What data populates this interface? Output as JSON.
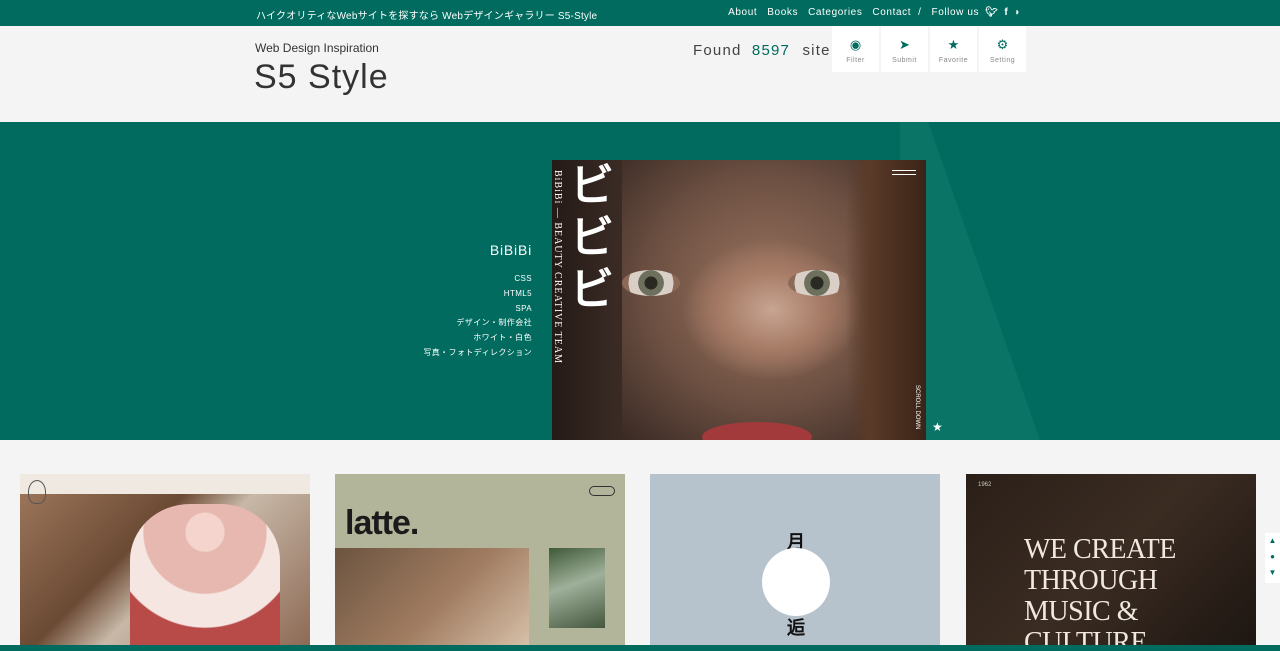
{
  "topbar": {
    "tagline": "ハイクオリティなWebサイトを探すなら Webデザインギャラリー S5-Style",
    "nav": [
      "About",
      "Books",
      "Categories",
      "Contact"
    ],
    "separator": "/",
    "follow": "Follow us",
    "social_icons": [
      "twitter-icon",
      "facebook-icon",
      "rss-icon"
    ]
  },
  "header": {
    "subtitle": "Web Design Inspiration",
    "logo": "S5 Style",
    "found_label": "Found",
    "found_count": "8597",
    "found_unit": "site",
    "tools": [
      {
        "label": "Filter",
        "icon": "eye-icon",
        "glyph": "◉"
      },
      {
        "label": "Submit",
        "icon": "send-icon",
        "glyph": "➤"
      },
      {
        "label": "Favorite",
        "icon": "star-icon",
        "glyph": "★"
      },
      {
        "label": "Setting",
        "icon": "gear-icon",
        "glyph": "⚙"
      }
    ]
  },
  "featured": {
    "title": "BiBiBi",
    "tags": [
      "CSS",
      "HTML5",
      "SPA",
      "デザイン・制作会社",
      "ホワイト・白色",
      "写真・フォトディレクション"
    ],
    "screenshot_vertical_text": "BiBiBi — BEAUTY CREATIVE TEAM",
    "screenshot_kana": [
      "ビ",
      "ビ",
      "ビ"
    ],
    "screenshot_scroll": "SCROLL DOWN"
  },
  "gallery": [
    {
      "name": "kimono-site",
      "kind": "photo"
    },
    {
      "name": "latte",
      "headline": "latte."
    },
    {
      "name": "tsuki",
      "top_char": "月",
      "bottom_char": "逅"
    },
    {
      "name": "music-culture",
      "headline_lines": [
        "WE CREATE",
        "THROUGH",
        "MUSIC & CULTURE"
      ],
      "corner": "1962"
    }
  ],
  "colors": {
    "brand": "#006b5e",
    "background": "#f4f4f4"
  }
}
